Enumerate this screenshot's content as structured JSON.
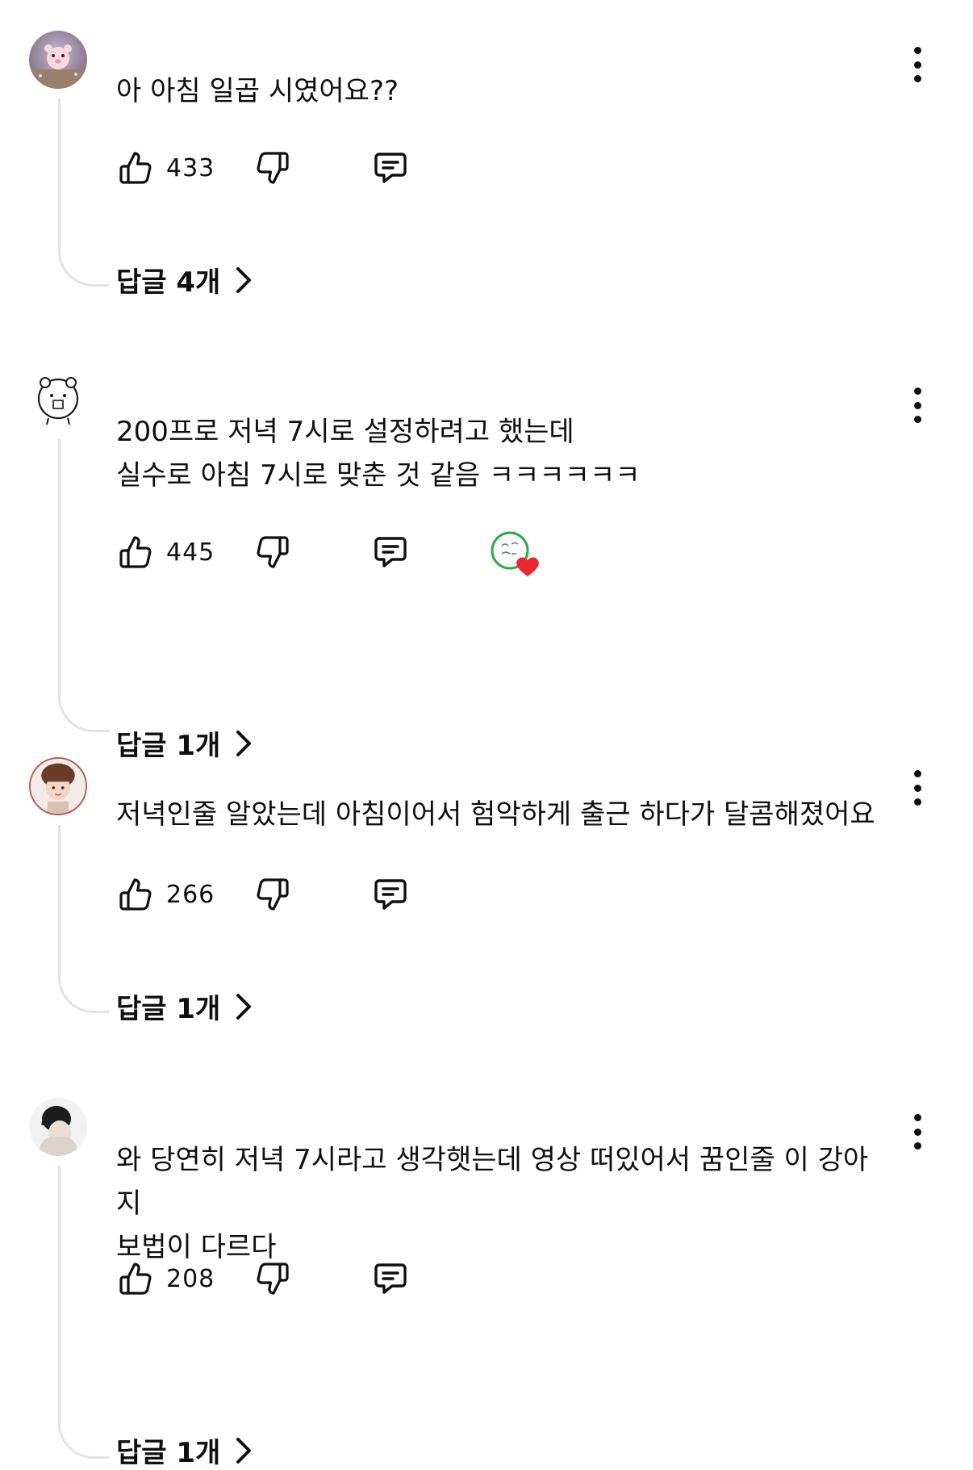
{
  "comments": [
    {
      "text": "아 아침 일곱 시였어요??",
      "likes": "433",
      "replies_label": "답글 4개",
      "hearted": false
    },
    {
      "text": "200프로 저녁 7시로 설정하려고 했는데\n실수로 아침 7시로 맞춘 것 같음 ㅋㅋㅋㅋㅋㅋ",
      "likes": "445",
      "replies_label": "답글 1개",
      "hearted": true
    },
    {
      "text": "저녁인줄 알았는데 아침이어서 험악하게 출근 하다가 달콤해졌어요",
      "likes": "266",
      "replies_label": "답글 1개",
      "hearted": false
    },
    {
      "text": "와 당연히 저녁 7시라고 생각햇는데 영상 떠있어서 꿈인줄 이 강아지\n보법이 다르다",
      "likes": "208",
      "replies_label": "답글 1개",
      "hearted": false
    }
  ],
  "colors": {
    "text": "#0f0f0f",
    "thread_line": "#e3e3e3",
    "heart": "#e8272e"
  },
  "icons": [
    "thumb-up-icon",
    "thumb-down-icon",
    "reply-icon",
    "more-vert-icon",
    "chevron-right-icon",
    "heart-icon"
  ]
}
